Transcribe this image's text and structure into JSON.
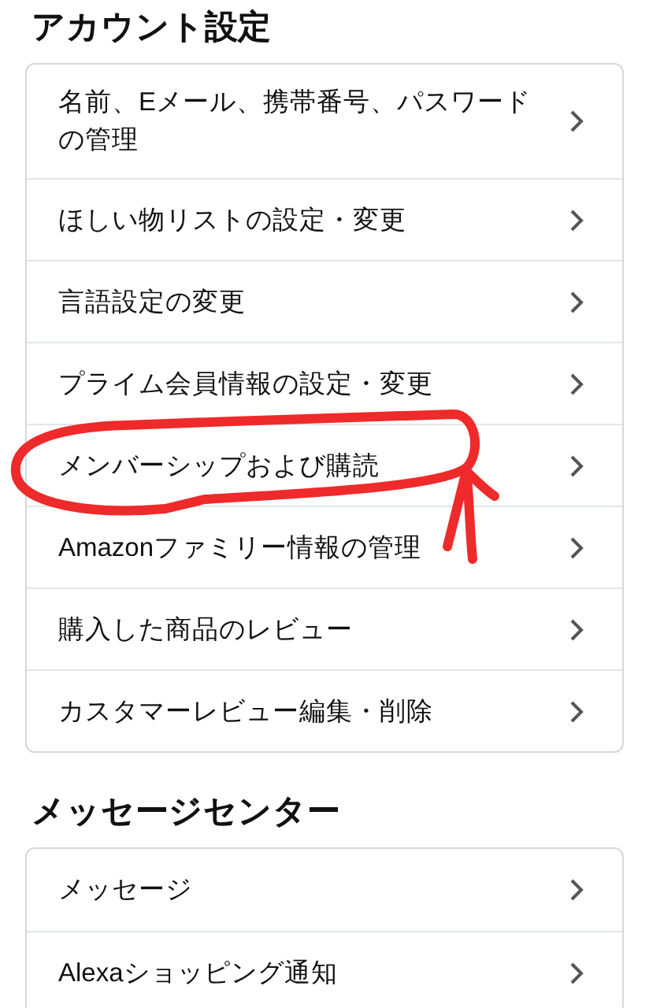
{
  "sections": [
    {
      "title": "アカウント設定",
      "items": [
        {
          "label": "名前、Eメール、携帯番号、パスワードの管理",
          "circled": false
        },
        {
          "label": "ほしい物リストの設定・変更",
          "circled": false
        },
        {
          "label": "言語設定の変更",
          "circled": false
        },
        {
          "label": "プライム会員情報の設定・変更",
          "circled": false
        },
        {
          "label": "メンバーシップおよび購読",
          "circled": true
        },
        {
          "label": "Amazonファミリー情報の管理",
          "circled": false
        },
        {
          "label": "購入した商品のレビュー",
          "circled": false
        },
        {
          "label": "カスタマーレビュー編集・削除",
          "circled": false
        }
      ]
    },
    {
      "title": "メッセージセンター",
      "items": [
        {
          "label": "メッセージ",
          "circled": false
        },
        {
          "label": "Alexaショッピング通知",
          "circled": false
        }
      ]
    }
  ]
}
